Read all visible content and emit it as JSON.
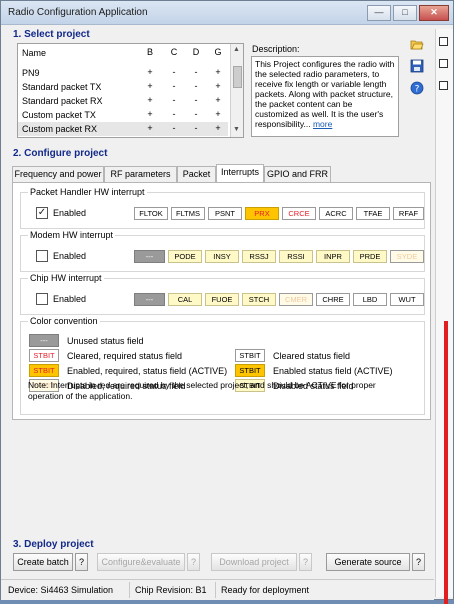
{
  "window": {
    "title": "Radio Configuration Application",
    "minimize_label": "—",
    "maximize_label": "□",
    "close_label": "✕"
  },
  "select_project": {
    "title": "1. Select project",
    "columns": [
      "Name",
      "B",
      "C",
      "D",
      "G"
    ],
    "rows": [
      {
        "name": "PN9",
        "b": "+",
        "c": "-",
        "d": "-",
        "g": "+"
      },
      {
        "name": "Standard packet TX",
        "b": "+",
        "c": "-",
        "d": "-",
        "g": "+"
      },
      {
        "name": "Standard packet RX",
        "b": "+",
        "c": "-",
        "d": "-",
        "g": "+"
      },
      {
        "name": "Custom packet TX",
        "b": "+",
        "c": "-",
        "d": "-",
        "g": "+"
      },
      {
        "name": "Custom packet RX",
        "b": "+",
        "c": "-",
        "d": "-",
        "g": "+"
      }
    ],
    "selected_row": "Custom packet RX",
    "description_label": "Description:",
    "description_text": "This Project configures the radio with the selected radio parameters, to receive fix length or variable length packets. Along with packet structure, the packet content can be customized as well. It is the user's responsibility...",
    "more_link": "more"
  },
  "configure": {
    "title": "2. Configure project",
    "tabs": [
      "Frequency and power",
      "RF parameters",
      "Packet",
      "Interrupts",
      "GPIO and FRR"
    ],
    "active_tab": "Interrupts",
    "packet_handler": {
      "label": "Packet Handler HW interrupt",
      "enabled_label": "Enabled",
      "enabled": true,
      "bits": [
        "FLTOK",
        "FLTMS",
        "PSNT",
        "PRX",
        "CRCE",
        "ACRC",
        "TFAE",
        "RFAF"
      ]
    },
    "modem": {
      "label": "Modem HW interrupt",
      "enabled_label": "Enabled",
      "enabled": false,
      "unused": "---",
      "bits": [
        "PODE",
        "INSY",
        "RSSJ",
        "RSSI",
        "INPR",
        "PRDE",
        "SYDE"
      ]
    },
    "chip": {
      "label": "Chip HW interrupt",
      "enabled_label": "Enabled",
      "enabled": false,
      "unused": "---",
      "bits": [
        "CAL",
        "FUOE",
        "STCH",
        "CMER",
        "CHRE",
        "LBD",
        "WUT"
      ]
    },
    "color_convention": {
      "label": "Color convention",
      "unused_sample": "---",
      "unused_text": "Unused status field",
      "sample": "STBIT",
      "cleared_required": "Cleared, required status field",
      "cleared": "Cleared status field",
      "enabled_required": "Enabled, required, status field (ACTIVE)",
      "enabled": "Enabled status field (ACTIVE)",
      "disabled_required": "Disabled, required status field",
      "disabled": "Disabled status field",
      "note": "Note: Interrupts in red are required by the selected project, and should be ACTIVE for proper operation of the application."
    }
  },
  "deploy": {
    "title": "3. Deploy project",
    "create_batch": "Create batch",
    "configure_evaluate": "Configure&evaluate",
    "download_project": "Download project",
    "generate_source": "Generate source",
    "help": "?"
  },
  "status_bar": {
    "device": "Device: Si4463  Simulation",
    "chip_revision": "Chip Revision: B1",
    "status": "Ready for deployment"
  },
  "colors": {
    "section_title": "#12298a",
    "active_bit": "#ffc400",
    "required_bit_text": "#e2202a",
    "unused_bit": "#9a9a9a",
    "disabled_bit": "#fff9c8"
  }
}
